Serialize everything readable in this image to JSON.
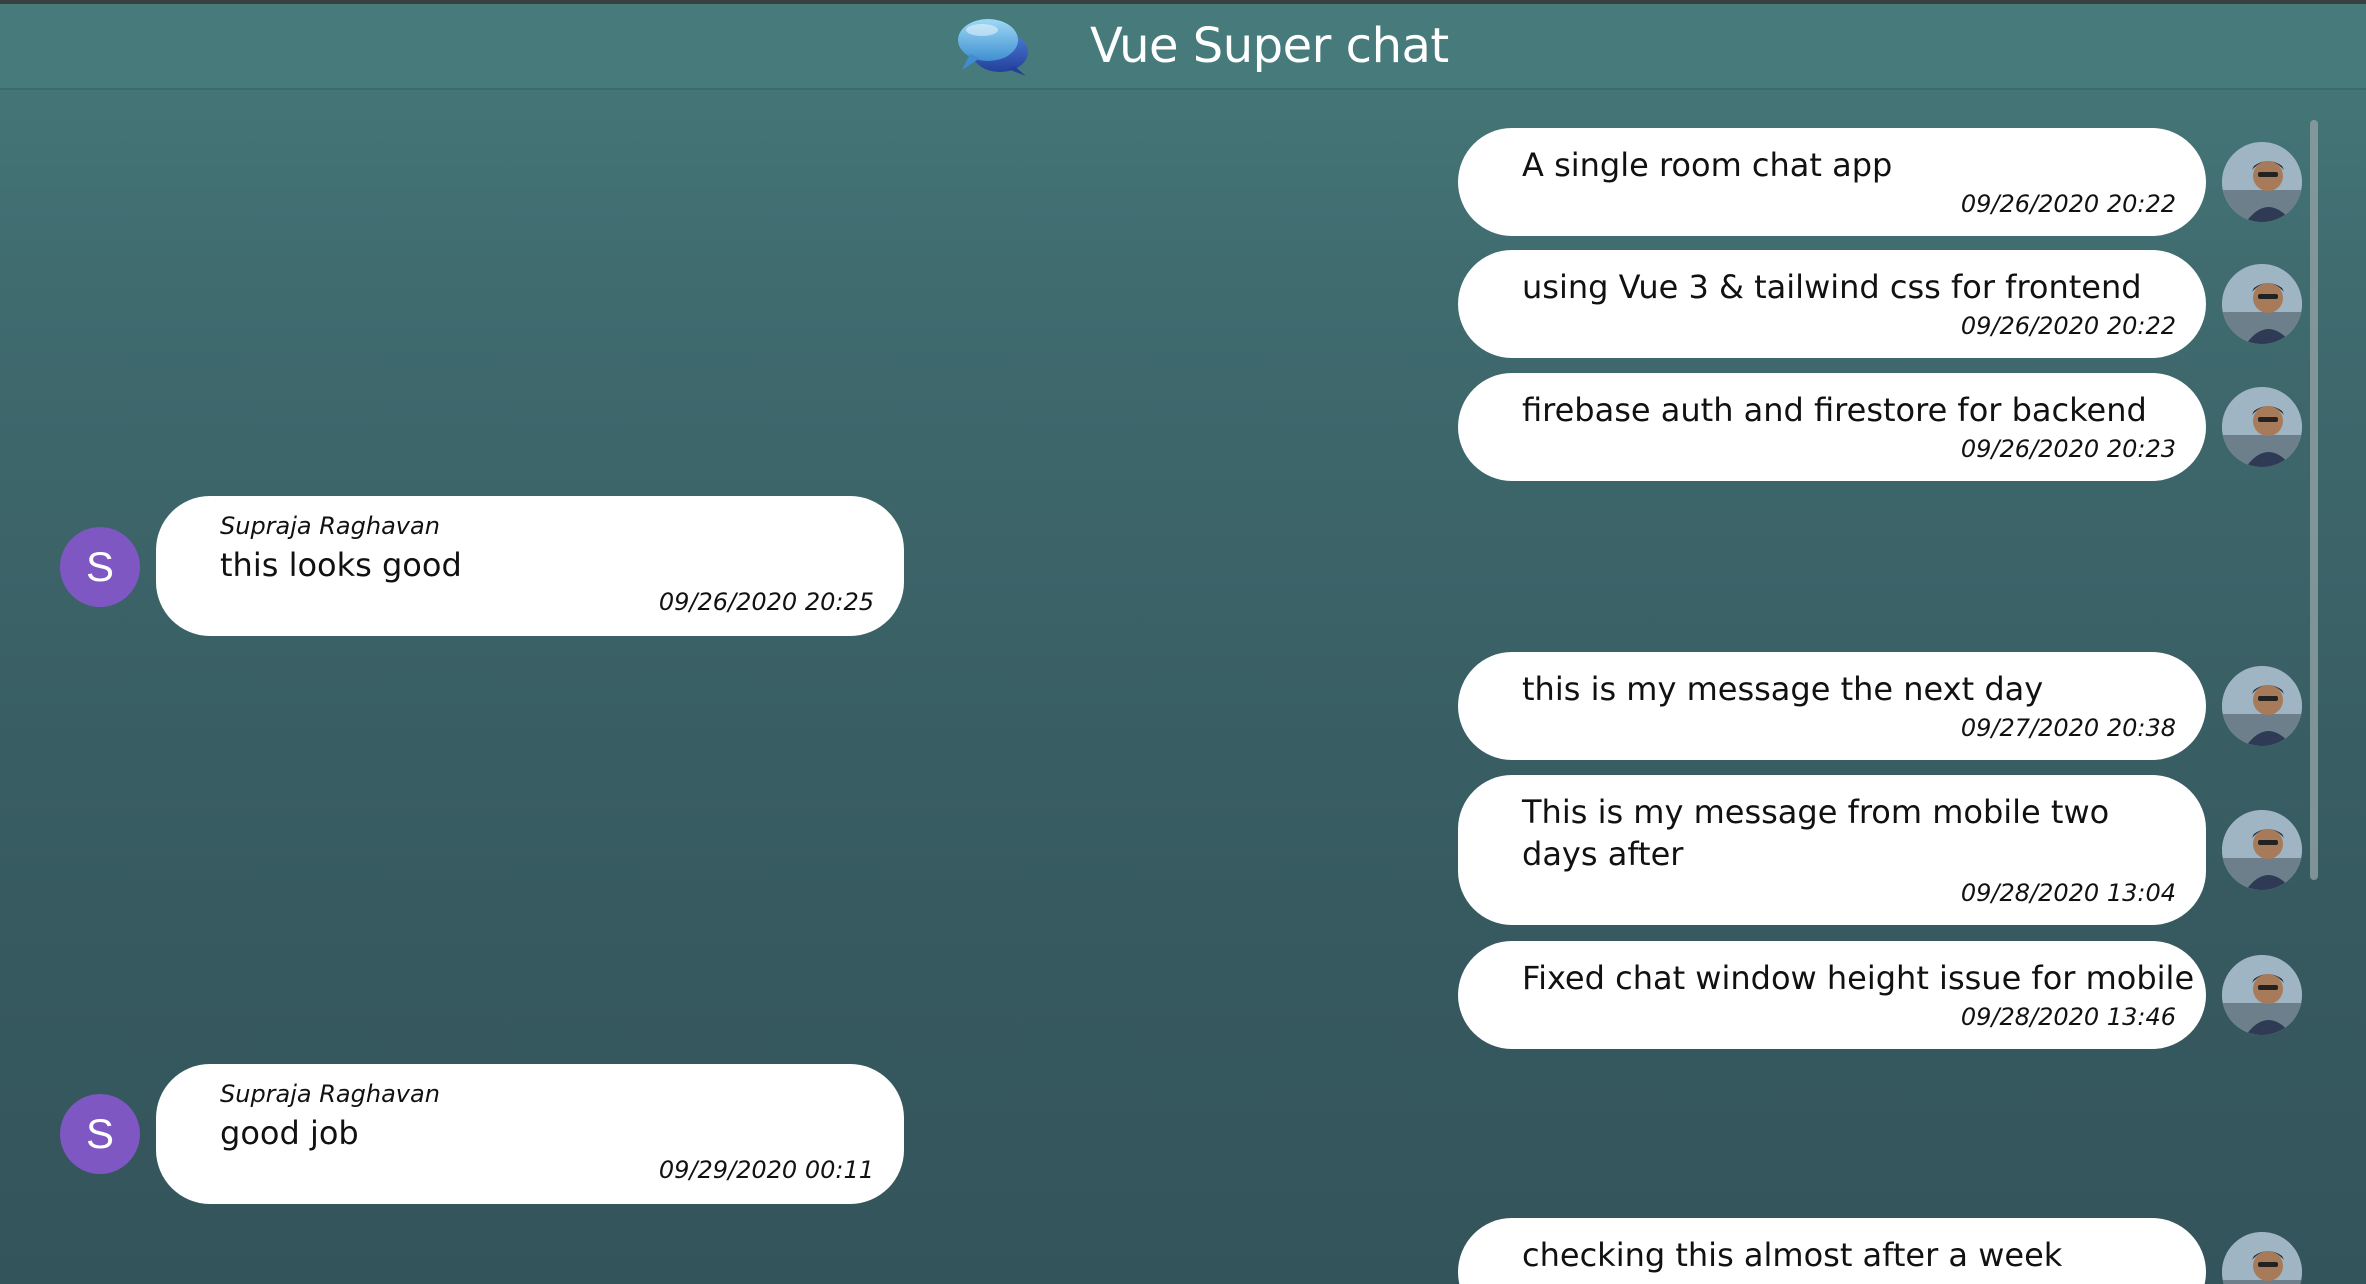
{
  "header": {
    "title": "Vue Super chat",
    "logo_icon": "chat-bubbles-icon"
  },
  "colors": {
    "bubble": "#ffffff",
    "avatar_letter_bg": "#7e57c2",
    "header_bg": "#467a7b"
  },
  "messages": [
    {
      "side": "right",
      "text": "A single room chat app",
      "time": "09/26/2020 20:22"
    },
    {
      "side": "right",
      "text": "using Vue 3 & tailwind css for frontend",
      "time": "09/26/2020 20:22"
    },
    {
      "side": "right",
      "text": "firebase auth and firestore for backend",
      "time": "09/26/2020 20:23"
    },
    {
      "side": "left",
      "sender": "Supraja Raghavan",
      "avatar_letter": "S",
      "text": "this looks good",
      "time": "09/26/2020 20:25"
    },
    {
      "side": "right",
      "text": "this is my message the next day",
      "time": "09/27/2020 20:38"
    },
    {
      "side": "right",
      "text": "This is my message from mobile two days after",
      "time": "09/28/2020 13:04"
    },
    {
      "side": "right",
      "text": "Fixed chat window height issue for mobile",
      "time": "09/28/2020 13:46"
    },
    {
      "side": "left",
      "sender": "Supraja Raghavan",
      "avatar_letter": "S",
      "text": "good job",
      "time": "09/29/2020 00:11"
    },
    {
      "side": "right",
      "text": "checking this almost after a week",
      "time": ""
    }
  ]
}
